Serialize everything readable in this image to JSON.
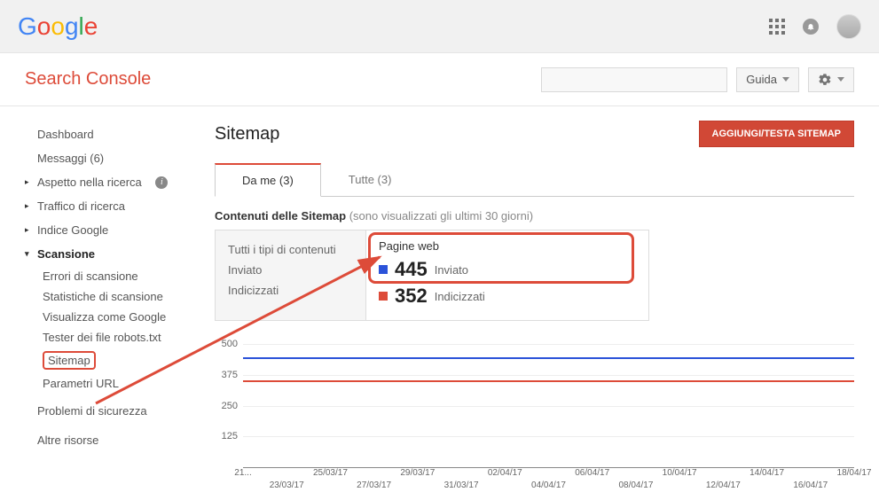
{
  "topbar": {
    "logo_alt": "Google"
  },
  "secondbar": {
    "brand": "Search Console",
    "guide_label": "Guida"
  },
  "sidebar": {
    "dashboard": "Dashboard",
    "messages": "Messaggi (6)",
    "search_appearance": "Aspetto nella ricerca",
    "search_traffic": "Traffico di ricerca",
    "google_index": "Indice Google",
    "crawl": "Scansione",
    "crawl_errors": "Errori di scansione",
    "crawl_stats": "Statistiche di scansione",
    "fetch_google": "Visualizza come Google",
    "robots": "Tester dei file robots.txt",
    "sitemap": "Sitemap",
    "url_params": "Parametri URL",
    "security": "Problemi di sicurezza",
    "other": "Altre risorse"
  },
  "content": {
    "title": "Sitemap",
    "add_button": "AGGIUNGI/TESTA SITEMAP",
    "tab_mine": "Da me (3)",
    "tab_all": "Tutte (3)",
    "subtitle_strong": "Contenuti delle Sitemap",
    "subtitle_muted": " (sono visualizzati gli ultimi 30 giorni)",
    "ct_all_types": "Tutti i tipi di contenuti",
    "ct_submitted": "Inviato",
    "ct_indexed": "Indicizzati",
    "ct_webpages": "Pagine web",
    "stat_submitted_val": "445",
    "stat_submitted_lbl": "Inviato",
    "stat_indexed_val": "352",
    "stat_indexed_lbl": "Indicizzati"
  },
  "chart_data": {
    "type": "line",
    "ylabel": "",
    "xlabel": "",
    "ylim": [
      0,
      500
    ],
    "y_ticks": [
      125,
      250,
      375,
      500
    ],
    "x_ticks_row1": [
      "21...",
      "25/03/17",
      "29/03/17",
      "02/04/17",
      "06/04/17",
      "10/04/17",
      "14/04/17",
      "18/04/17"
    ],
    "x_ticks_row2": [
      "23/03/17",
      "27/03/17",
      "31/03/17",
      "04/04/17",
      "08/04/17",
      "12/04/17",
      "16/04/17"
    ],
    "series": [
      {
        "name": "Inviato",
        "color": "#2b53d9",
        "approx_value": 445
      },
      {
        "name": "Indicizzati",
        "color": "#dd4b39",
        "approx_value": 352
      }
    ]
  }
}
